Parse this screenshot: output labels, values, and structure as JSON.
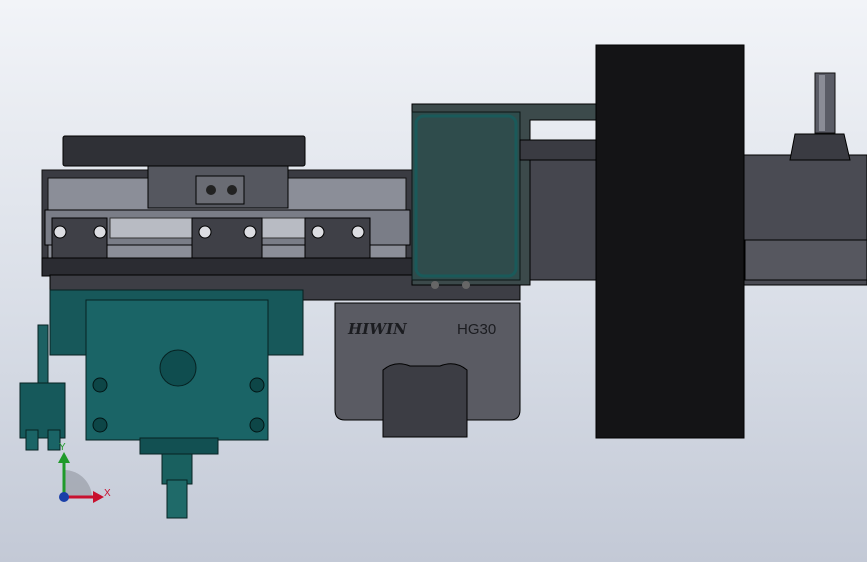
{
  "model": {
    "rail_brand_text": "HIWIN",
    "rail_model_text": "HG30"
  },
  "triad": {
    "x_label": "X",
    "y_label": "Y",
    "x_color": "#c8102e",
    "y_color": "#1f9a2a",
    "z_color": "#1a3fa8"
  },
  "colors": {
    "background_top": "#f2f4f8",
    "background_bottom": "#c3c9d6",
    "teal_part": "#17585a",
    "dark_part": "#2a2b30",
    "grey_part": "#4a4c55",
    "rail_block": "#5a5b63",
    "motor_disc": "#141416"
  }
}
